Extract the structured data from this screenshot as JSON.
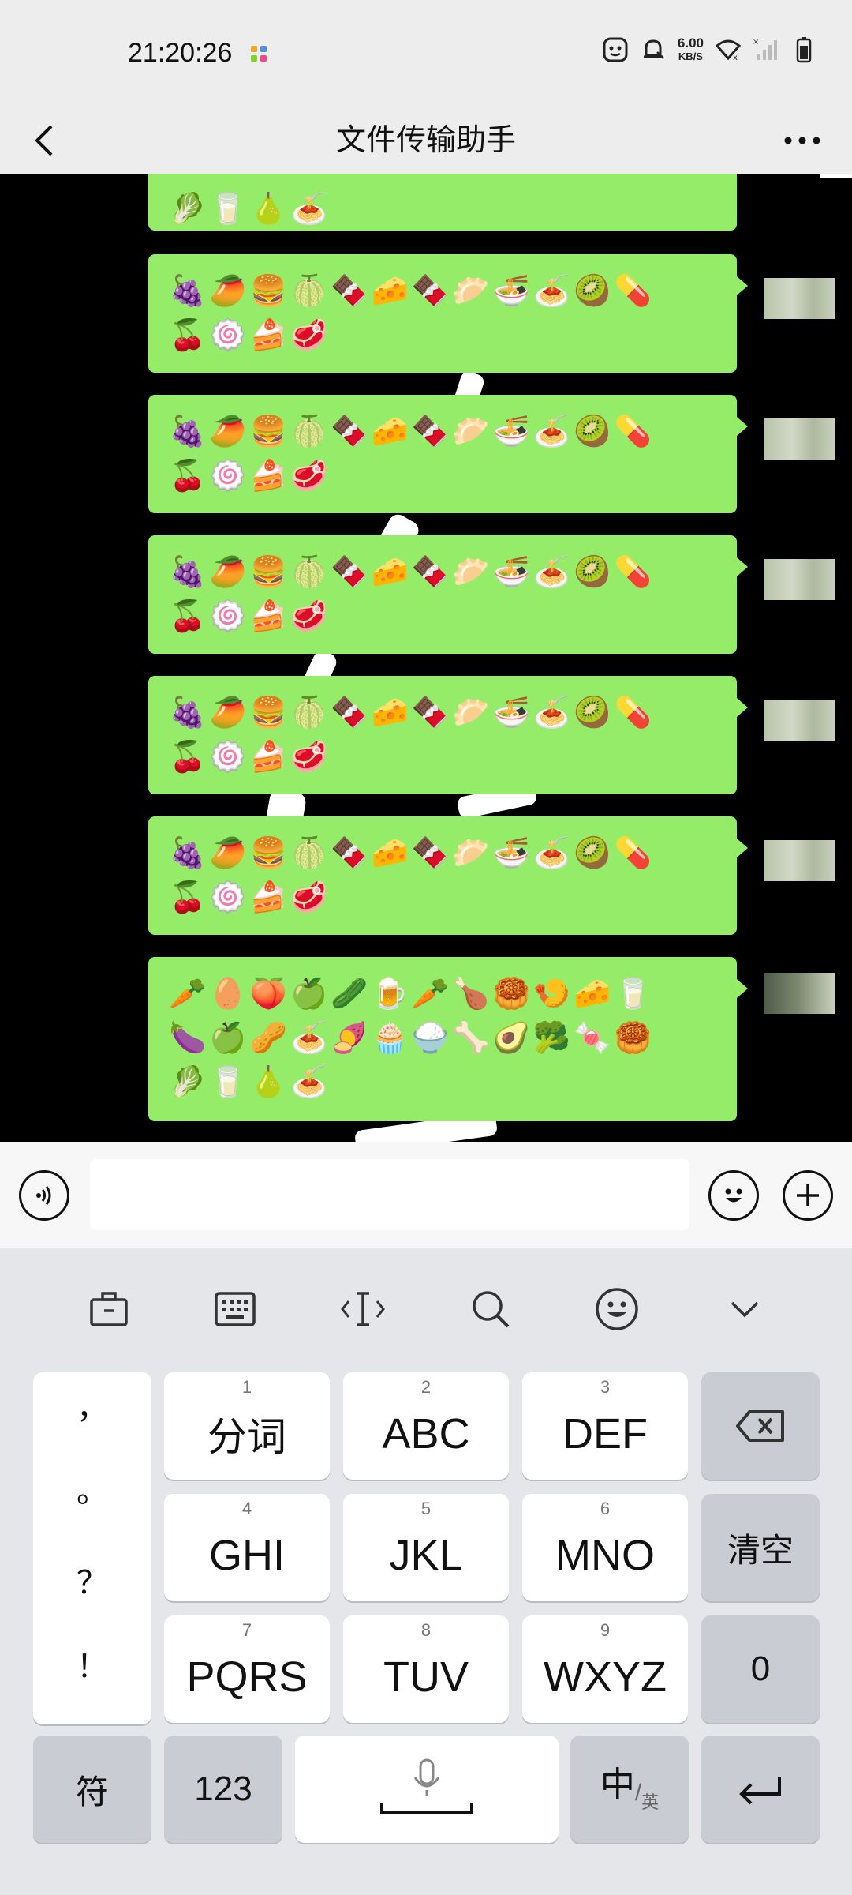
{
  "status_bar": {
    "time": "21:20:26",
    "speed_value": "6.00",
    "speed_unit": "KB/S"
  },
  "header": {
    "title": "文件传输助手"
  },
  "messages": [
    {
      "lines": [
        "🥬🥛🍐🍝"
      ],
      "partial": true
    },
    {
      "lines": [
        "🍇🥭🍔🍈🍫🧀🍫🥟🍜🍝🥝💊",
        "🍒🍥🍰🥩"
      ]
    },
    {
      "lines": [
        "🍇🥭🍔🍈🍫🧀🍫🥟🍜🍝🥝💊",
        "🍒🍥🍰🥩"
      ]
    },
    {
      "lines": [
        "🍇🥭🍔🍈🍫🧀🍫🥟🍜🍝🥝💊",
        "🍒🍥🍰🥩"
      ]
    },
    {
      "lines": [
        "🍇🥭🍔🍈🍫🧀🍫🥟🍜🍝🥝💊",
        "🍒🍥🍰🥩"
      ]
    },
    {
      "lines": [
        "🍇🥭🍔🍈🍫🧀🍫🥟🍜🍝🥝💊",
        "🍒🍥🍰🥩"
      ]
    },
    {
      "lines": [
        "🥕🥚🍑🍏🥒🍺🥕🍗🥮🍤🧀🥛",
        "🍆🍏🥜🍝🍠🧁🍚🦴🥑🥦🍬🥮",
        "🥬🥛🍐🍝"
      ]
    }
  ],
  "input": {
    "value": "",
    "placeholder": ""
  },
  "keyboard": {
    "punctuation": [
      "，",
      "。",
      "？",
      "！"
    ],
    "rows": [
      [
        {
          "num": "1",
          "label": "分词"
        },
        {
          "num": "2",
          "label": "ABC"
        },
        {
          "num": "3",
          "label": "DEF"
        }
      ],
      [
        {
          "num": "4",
          "label": "GHI"
        },
        {
          "num": "5",
          "label": "JKL"
        },
        {
          "num": "6",
          "label": "MNO"
        }
      ],
      [
        {
          "num": "7",
          "label": "PQRS"
        },
        {
          "num": "8",
          "label": "TUV"
        },
        {
          "num": "9",
          "label": "WXYZ"
        }
      ]
    ],
    "clear_label": "清空",
    "zero_label": "0",
    "symbols_label": "符",
    "numbers_label": "123",
    "lang_main": "中",
    "lang_sub": "英"
  },
  "colors": {
    "bubble": "#95ec69",
    "chat_bg": "#000000",
    "bar_bg": "#ededed",
    "keyboard_bg": "#e4e6ea"
  }
}
